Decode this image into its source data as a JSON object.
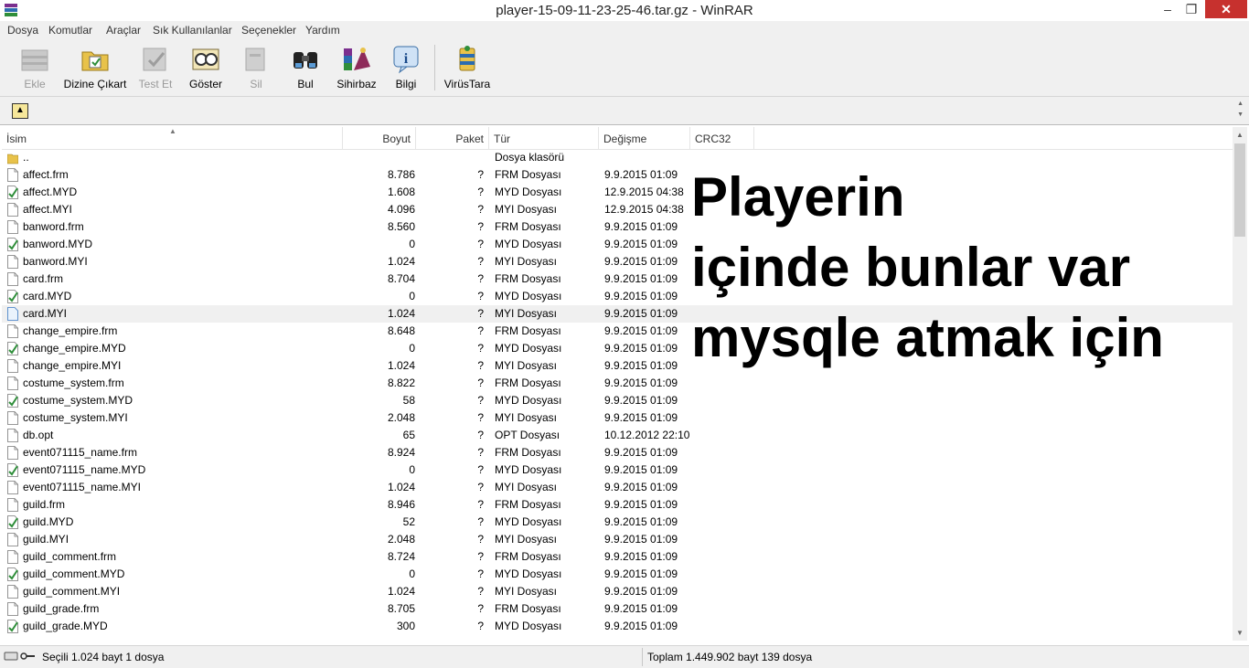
{
  "window": {
    "title": "player-15-09-11-23-25-46.tar.gz - WinRAR",
    "minimize": "–",
    "maximize": "❐",
    "close": "✕"
  },
  "menu": [
    "Dosya",
    "Komutlar",
    "Araçlar",
    "Sık Kullanılanlar",
    "Seçenekler",
    "Yardım"
  ],
  "toolbar": [
    {
      "label": "Ekle",
      "icon": "add-archive-icon",
      "enabled": false
    },
    {
      "label": "Dizine Çıkart",
      "icon": "extract-to-icon",
      "enabled": true
    },
    {
      "label": "Test Et",
      "icon": "test-icon",
      "enabled": false
    },
    {
      "label": "Göster",
      "icon": "view-icon",
      "enabled": true
    },
    {
      "label": "Sil",
      "icon": "delete-icon",
      "enabled": false
    },
    {
      "label": "Bul",
      "icon": "find-icon",
      "enabled": true
    },
    {
      "label": "Sihirbaz",
      "icon": "wizard-icon",
      "enabled": true
    },
    {
      "label": "Bilgi",
      "icon": "info-icon",
      "enabled": true
    },
    {
      "label": "VirüsTara",
      "icon": "virus-scan-icon",
      "enabled": true
    }
  ],
  "columns": {
    "name": "İsim",
    "size": "Boyut",
    "packed": "Paket",
    "type": "Tür",
    "modified": "Değişme",
    "crc": "CRC32"
  },
  "rows": [
    {
      "name": "..",
      "size": "",
      "packed": "",
      "type": "Dosya klasörü",
      "modified": "",
      "icon": "folder"
    },
    {
      "name": "affect.frm",
      "size": "8.786",
      "packed": "?",
      "type": "FRM Dosyası",
      "modified": "9.9.2015 01:09",
      "icon": "file"
    },
    {
      "name": "affect.MYD",
      "size": "1.608",
      "packed": "?",
      "type": "MYD Dosyası",
      "modified": "12.9.2015 04:38",
      "icon": "myd"
    },
    {
      "name": "affect.MYI",
      "size": "4.096",
      "packed": "?",
      "type": "MYI Dosyası",
      "modified": "12.9.2015 04:38",
      "icon": "file"
    },
    {
      "name": "banword.frm",
      "size": "8.560",
      "packed": "?",
      "type": "FRM Dosyası",
      "modified": "9.9.2015 01:09",
      "icon": "file"
    },
    {
      "name": "banword.MYD",
      "size": "0",
      "packed": "?",
      "type": "MYD Dosyası",
      "modified": "9.9.2015 01:09",
      "icon": "myd"
    },
    {
      "name": "banword.MYI",
      "size": "1.024",
      "packed": "?",
      "type": "MYI Dosyası",
      "modified": "9.9.2015 01:09",
      "icon": "file"
    },
    {
      "name": "card.frm",
      "size": "8.704",
      "packed": "?",
      "type": "FRM Dosyası",
      "modified": "9.9.2015 01:09",
      "icon": "file"
    },
    {
      "name": "card.MYD",
      "size": "0",
      "packed": "?",
      "type": "MYD Dosyası",
      "modified": "9.9.2015 01:09",
      "icon": "myd"
    },
    {
      "name": "card.MYI",
      "size": "1.024",
      "packed": "?",
      "type": "MYI Dosyası",
      "modified": "9.9.2015 01:09",
      "icon": "file-blue",
      "selected": true
    },
    {
      "name": "change_empire.frm",
      "size": "8.648",
      "packed": "?",
      "type": "FRM Dosyası",
      "modified": "9.9.2015 01:09",
      "icon": "file"
    },
    {
      "name": "change_empire.MYD",
      "size": "0",
      "packed": "?",
      "type": "MYD Dosyası",
      "modified": "9.9.2015 01:09",
      "icon": "myd"
    },
    {
      "name": "change_empire.MYI",
      "size": "1.024",
      "packed": "?",
      "type": "MYI Dosyası",
      "modified": "9.9.2015 01:09",
      "icon": "file"
    },
    {
      "name": "costume_system.frm",
      "size": "8.822",
      "packed": "?",
      "type": "FRM Dosyası",
      "modified": "9.9.2015 01:09",
      "icon": "file"
    },
    {
      "name": "costume_system.MYD",
      "size": "58",
      "packed": "?",
      "type": "MYD Dosyası",
      "modified": "9.9.2015 01:09",
      "icon": "myd"
    },
    {
      "name": "costume_system.MYI",
      "size": "2.048",
      "packed": "?",
      "type": "MYI Dosyası",
      "modified": "9.9.2015 01:09",
      "icon": "file"
    },
    {
      "name": "db.opt",
      "size": "65",
      "packed": "?",
      "type": "OPT Dosyası",
      "modified": "10.12.2012 22:10",
      "icon": "file"
    },
    {
      "name": "event071115_name.frm",
      "size": "8.924",
      "packed": "?",
      "type": "FRM Dosyası",
      "modified": "9.9.2015 01:09",
      "icon": "file"
    },
    {
      "name": "event071115_name.MYD",
      "size": "0",
      "packed": "?",
      "type": "MYD Dosyası",
      "modified": "9.9.2015 01:09",
      "icon": "myd"
    },
    {
      "name": "event071115_name.MYI",
      "size": "1.024",
      "packed": "?",
      "type": "MYI Dosyası",
      "modified": "9.9.2015 01:09",
      "icon": "file"
    },
    {
      "name": "guild.frm",
      "size": "8.946",
      "packed": "?",
      "type": "FRM Dosyası",
      "modified": "9.9.2015 01:09",
      "icon": "file"
    },
    {
      "name": "guild.MYD",
      "size": "52",
      "packed": "?",
      "type": "MYD Dosyası",
      "modified": "9.9.2015 01:09",
      "icon": "myd"
    },
    {
      "name": "guild.MYI",
      "size": "2.048",
      "packed": "?",
      "type": "MYI Dosyası",
      "modified": "9.9.2015 01:09",
      "icon": "file"
    },
    {
      "name": "guild_comment.frm",
      "size": "8.724",
      "packed": "?",
      "type": "FRM Dosyası",
      "modified": "9.9.2015 01:09",
      "icon": "file"
    },
    {
      "name": "guild_comment.MYD",
      "size": "0",
      "packed": "?",
      "type": "MYD Dosyası",
      "modified": "9.9.2015 01:09",
      "icon": "myd"
    },
    {
      "name": "guild_comment.MYI",
      "size": "1.024",
      "packed": "?",
      "type": "MYI Dosyası",
      "modified": "9.9.2015 01:09",
      "icon": "file"
    },
    {
      "name": "guild_grade.frm",
      "size": "8.705",
      "packed": "?",
      "type": "FRM Dosyası",
      "modified": "9.9.2015 01:09",
      "icon": "file"
    },
    {
      "name": "guild_grade.MYD",
      "size": "300",
      "packed": "?",
      "type": "MYD Dosyası",
      "modified": "9.9.2015 01:09",
      "icon": "myd"
    }
  ],
  "overlay_text": [
    "Playerin",
    "içinde bunlar var",
    "mysqle atmak için"
  ],
  "status": {
    "left": "Seçili 1.024 bayt 1 dosya",
    "right": "Toplam 1.449.902 bayt 139 dosya"
  },
  "colors": {
    "close_button": "#c7312e",
    "selected_row": "#f0f0f0",
    "chrome": "#f0f0f0"
  }
}
